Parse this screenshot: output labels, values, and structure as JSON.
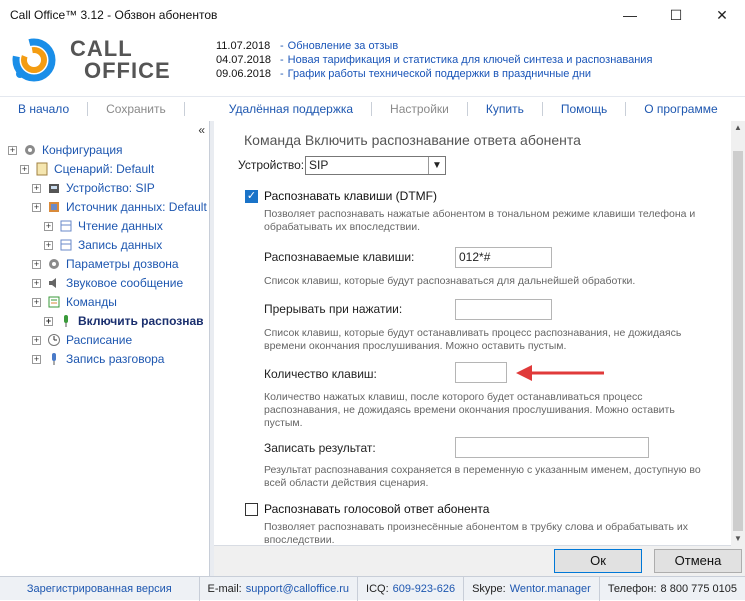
{
  "window": {
    "title": "Call Office™ 3.12 - Обзвон абонентов",
    "minimize": "—",
    "maximize": "☐",
    "close": "✕"
  },
  "logo": {
    "line1": "CALL",
    "line2": "OFFICE"
  },
  "news": [
    {
      "date": "11.07.2018",
      "text": "Обновление за отзыв"
    },
    {
      "date": "04.07.2018",
      "text": "Новая тарификация и статистика для ключей синтеза и распознавания"
    },
    {
      "date": "09.06.2018",
      "text": "График работы технической поддержки в праздничные дни"
    }
  ],
  "menu": {
    "home": "В начало",
    "save": "Сохранить",
    "remote": "Удалённая поддержка",
    "settings": "Настройки",
    "buy": "Купить",
    "help": "Помощь",
    "about": "О программе"
  },
  "tree": {
    "collapse": "«",
    "items": [
      {
        "label": "Конфигурация"
      },
      {
        "label": "Сценарий: Default"
      },
      {
        "label": "Устройство: SIP"
      },
      {
        "label": "Источник данных: Default"
      },
      {
        "label": "Чтение данных"
      },
      {
        "label": "Запись данных"
      },
      {
        "label": "Параметры дозвона"
      },
      {
        "label": "Звуковое сообщение"
      },
      {
        "label": "Команды"
      },
      {
        "label": "Включить распознав"
      },
      {
        "label": "Расписание"
      },
      {
        "label": "Запись разговора"
      }
    ]
  },
  "main": {
    "header": "Команда Включить распознавание ответа абонента",
    "device_label": "Устройство:",
    "device_value": "SIP",
    "dtmf": {
      "label": "Распознавать клавиши (DTMF)",
      "checked": true,
      "hint": "Позволяет распознавать нажатые абонентом в тональном режиме клавиши телефона и обрабатывать их впоследствии."
    },
    "keys": {
      "label": "Распознаваемые клавиши:",
      "value": "012*#",
      "hint": "Список клавиш, которые будут распознаваться для дальнейшей обработки."
    },
    "interrupt": {
      "label": "Прерывать при нажатии:",
      "value": "",
      "hint": "Список клавиш, которые будут останавливать процесс распознавания, не дожидаясь времени окончания прослушивания. Можно оставить пустым."
    },
    "count": {
      "label": "Количество клавиш:",
      "value": "",
      "hint": "Количество нажатых клавиш, после которого будет останавливаться процесс распознавания, не дожидаясь времени окончания прослушивания. Можно оставить пустым."
    },
    "result": {
      "label": "Записать результат:",
      "value": "",
      "hint": "Результат распознавания сохраняется в переменную с указанным именем, доступную во всей области действия сценария."
    },
    "voice": {
      "label": "Распознавать голосовой ответ абонента",
      "checked": false,
      "hint": "Позволяет распознавать произнесённые абонентом в трубку слова и обрабатывать их впоследствии."
    }
  },
  "buttons": {
    "ok": "Ок",
    "cancel": "Отмена"
  },
  "status": {
    "registered": "Зарегистрированная версия",
    "email_label": "E-mail:",
    "email": "support@calloffice.ru",
    "icq_label": "ICQ:",
    "icq": "609-923-626",
    "skype_label": "Skype:",
    "skype": "Wentor.manager",
    "phone_label": "Телефон:",
    "phone": "8 800 775 0105"
  },
  "colors": {
    "accent": "#1e57b0",
    "checkbox": "#1a73c8",
    "arrow": "#e03a3a"
  }
}
